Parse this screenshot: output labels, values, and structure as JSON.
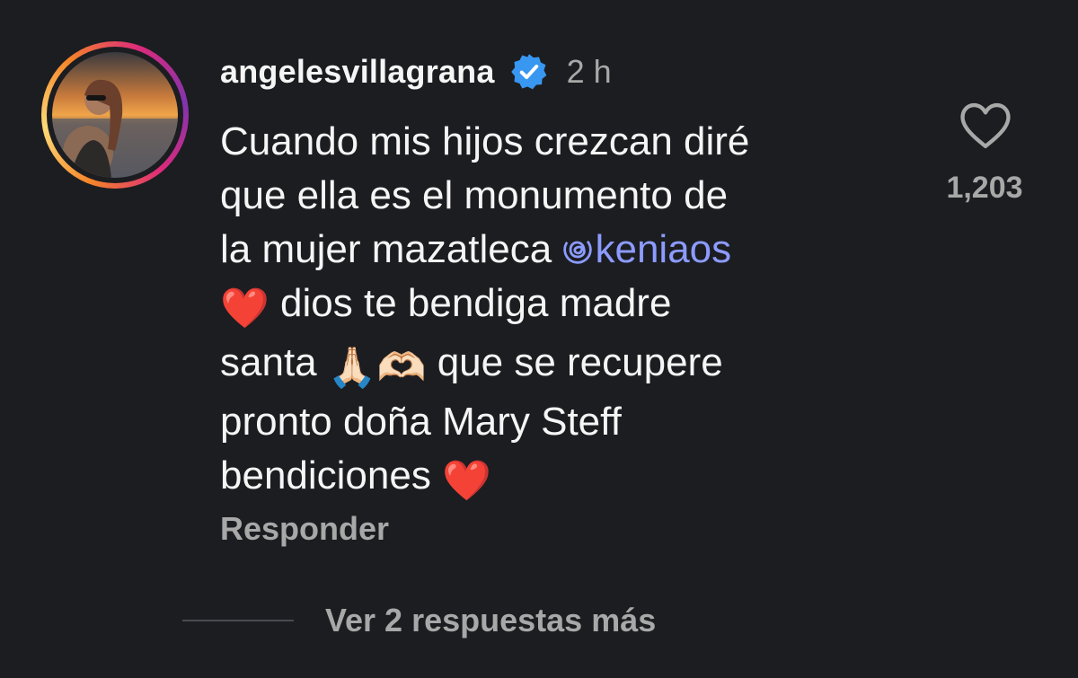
{
  "comment": {
    "username": "angelesvillagrana",
    "timestamp": "2 h",
    "verified_icon": "verified-badge-icon",
    "lines": {
      "l1": "Cuando mis hijos crezcan diré",
      "l2": "que ella es el monumento de",
      "l3_prefix": "la mujer mazatleca ",
      "mention": "keniaos",
      "l4_text": " dios te bendiga madre",
      "l5_prefix": "santa ",
      "l5_suffix": " que se recupere",
      "l6": "pronto doña Mary Steff",
      "l7": "bendiciones "
    },
    "emojis": {
      "heart": "❤️",
      "pray": "🙏🏻",
      "heart_hands": "🫶🏻"
    },
    "reply_label": "Responder",
    "like_count": "1,203",
    "like_icon": "heart-outline-icon",
    "view_replies_label": "Ver 2 respuestas más"
  },
  "colors": {
    "background": "#1c1d21",
    "text": "#f5f5f5",
    "secondary_text": "#a8a8a8",
    "mention": "#8c9bff",
    "verified": "#3897f0",
    "emoji_heart": "#f0365c"
  }
}
